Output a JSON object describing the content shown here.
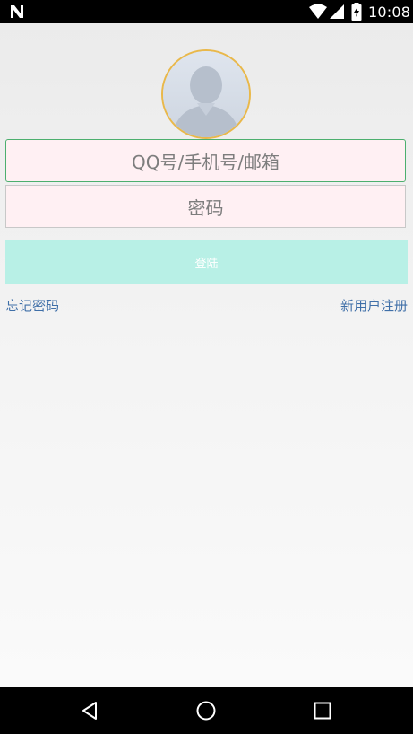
{
  "status_bar": {
    "time": "10:08",
    "icons": [
      "n-logo-icon",
      "wifi-icon",
      "cell-signal-icon",
      "battery-icon"
    ]
  },
  "login": {
    "avatar_icon": "default-avatar-icon",
    "account_placeholder": "QQ号/手机号/邮箱",
    "password_placeholder": "密码",
    "login_label": "登陆",
    "forgot_label": "忘记密码",
    "register_label": "新用户注册"
  },
  "nav_bar": {
    "icons": [
      "back-icon",
      "home-icon",
      "recents-icon"
    ]
  },
  "colors": {
    "field_background": "#fff0f3",
    "account_border": "#4caf6e",
    "avatar_border": "#e9b84a",
    "login_button": "#b8f0e6",
    "link": "#3f6fa8"
  }
}
